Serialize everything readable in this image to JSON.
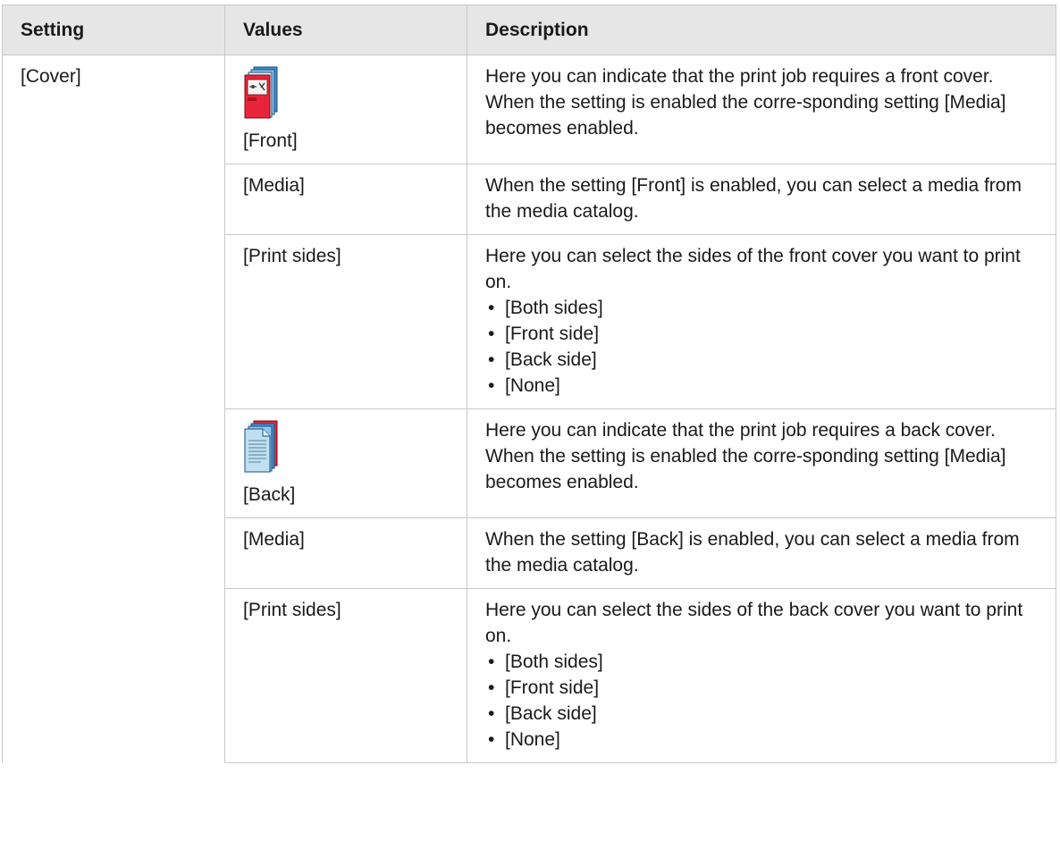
{
  "headers": {
    "setting": "Setting",
    "values": "Values",
    "description": "Description"
  },
  "setting_label": "[Cover]",
  "rows": [
    {
      "value": "[Front]",
      "icon": "front-cover-icon",
      "description": "Here you can indicate that the print job requires a front cover. When the setting is enabled the corre-sponding setting [Media] becomes enabled."
    },
    {
      "value": "[Media]",
      "description": "When the setting [Front] is enabled, you can select a media from the media catalog."
    },
    {
      "value": "[Print sides]",
      "description": "Here you can select the sides of the front cover you want to print on.",
      "options": [
        "[Both sides]",
        "[Front side]",
        "[Back side]",
        "[None]"
      ]
    },
    {
      "value": "[Back]",
      "icon": "back-cover-icon",
      "description": "Here you can indicate that the print job requires a back cover. When the setting is enabled the corre-sponding setting [Media] becomes enabled."
    },
    {
      "value": "[Media]",
      "description": "When the setting [Back] is enabled, you can select a media from the media catalog."
    },
    {
      "value": "[Print sides]",
      "description": "Here you can select the sides of the back cover you want to print on.",
      "options": [
        "[Both sides]",
        "[Front side]",
        "[Back side]",
        "[None]"
      ]
    }
  ],
  "colors": {
    "header_bg": "#e6e6e6",
    "border": "#c8c8c8",
    "front_icon_red": "#e8243a",
    "back_icon_blue": "#bfe0f0"
  }
}
